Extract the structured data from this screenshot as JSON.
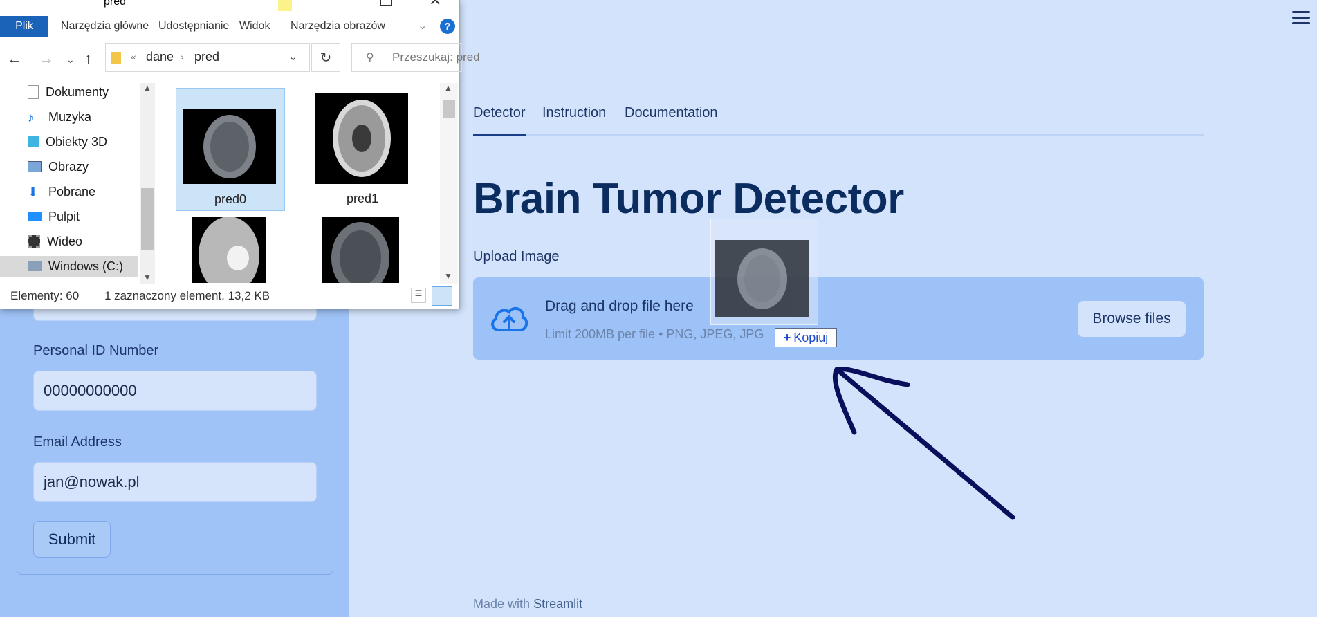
{
  "explorer": {
    "title": "pred",
    "ribbon": [
      "Plik",
      "Narzędzia główne",
      "Udostępnianie",
      "Widok",
      "Narzędzia obrazów"
    ],
    "help_glyph": "?",
    "address": {
      "prefix": "«",
      "crumbs": [
        "dane",
        "pred"
      ]
    },
    "search_placeholder": "Przeszukaj: pred",
    "nav_items": [
      "Dokumenty",
      "Muzyka",
      "Obiekty 3D",
      "Obrazy",
      "Pobrane",
      "Pulpit",
      "Wideo",
      "Windows (C:)"
    ],
    "files": [
      "pred0",
      "pred1"
    ],
    "status": {
      "count": "Elementy: 60",
      "selected": "1 zaznaczony element. 13,2 KB"
    }
  },
  "sidebar": {
    "fields": [
      {
        "label": "Personal ID Number",
        "value": "00000000000"
      },
      {
        "label": "Email Address",
        "value": "jan@nowak.pl"
      }
    ],
    "submit_label": "Submit"
  },
  "main": {
    "tabs": [
      "Detector",
      "Instruction",
      "Documentation"
    ],
    "active_tab": "Detector",
    "title": "Brain Tumor Detector",
    "upload_label": "Upload Image",
    "dropzone": {
      "title": "Drag and drop file here",
      "subtitle": "Limit 200MB per file • PNG, JPEG, JPG",
      "browse_label": "Browse files"
    },
    "drag_copy_label": "Kopiuj",
    "footer_prefix": "Made with",
    "footer_brand": "Streamlit"
  },
  "colors": {
    "sidebar_bg": "#9fc3f7",
    "main_bg": "#d3e3fb",
    "title": "#0b2c5e",
    "file_tab": "#1a63b8",
    "arrow": "#0a0f5c"
  }
}
